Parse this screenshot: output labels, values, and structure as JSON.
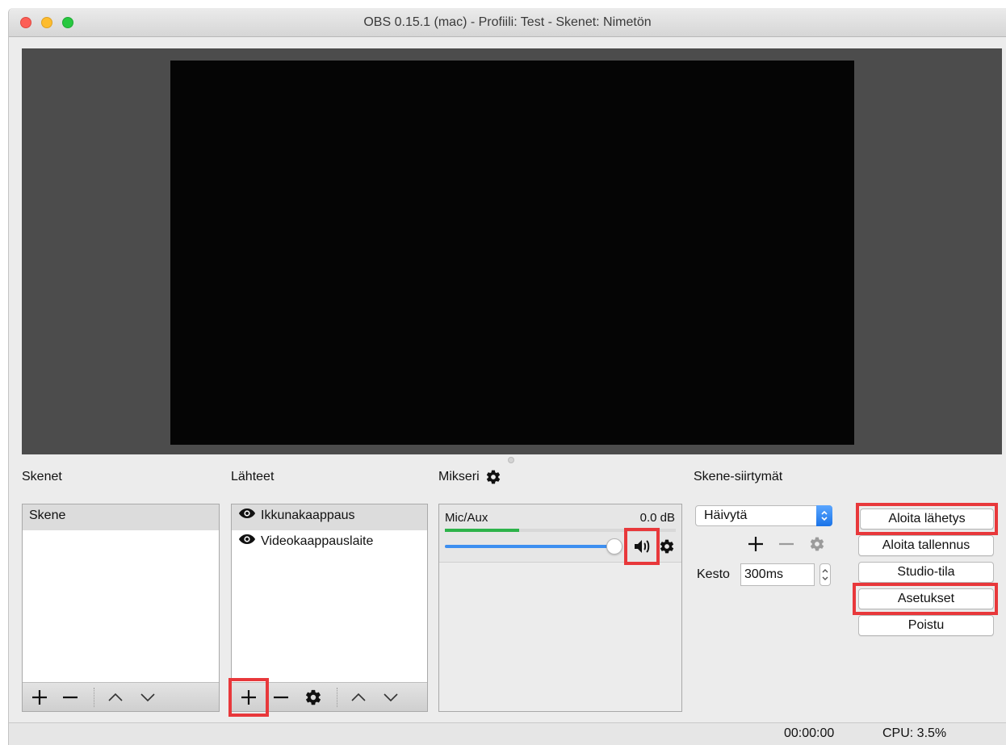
{
  "window": {
    "title": "OBS 0.15.1 (mac) - Profiili: Test - Skenet: Nimetön"
  },
  "docks": {
    "scenes": {
      "title": "Skenet",
      "items": [
        {
          "label": "Skene",
          "selected": true
        }
      ]
    },
    "sources": {
      "title": "Lähteet",
      "items": [
        {
          "label": "Ikkunakaappaus",
          "selected": true,
          "icon": "eye-icon"
        },
        {
          "label": "Videokaappauslaite",
          "selected": false,
          "icon": "eye-icon"
        }
      ]
    },
    "mixer": {
      "title": "Mikseri",
      "channel": {
        "name": "Mic/Aux",
        "level": "0.0 dB",
        "volume_fraction": 1.0,
        "meter_fraction": 0.32
      }
    },
    "transitions": {
      "title": "Skene-siirtymät",
      "selected_transition": "Häivytä",
      "duration_label": "Kesto",
      "duration_value": "300ms"
    },
    "controls": {
      "start_streaming": "Aloita lähetys",
      "start_recording": "Aloita tallennus",
      "studio_mode": "Studio-tila",
      "settings": "Asetukset",
      "exit": "Poistu"
    }
  },
  "statusbar": {
    "time": "00:00:00",
    "cpu": "CPU: 3.5%"
  },
  "colors": {
    "highlight": "#e8383b",
    "preview_bg": "#4c4c4c",
    "canvas_bg": "#050505",
    "slider_blue": "#3d8ff0",
    "meter_green": "#2db34a"
  }
}
